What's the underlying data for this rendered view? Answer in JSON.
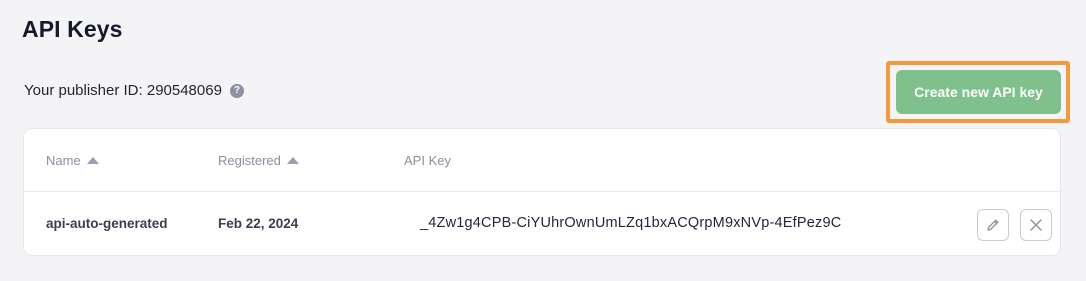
{
  "page": {
    "title": "API Keys"
  },
  "publisher": {
    "label": "Your publisher ID: 290548069",
    "help_icon": "question-icon"
  },
  "actions": {
    "create_label": "Create new API key"
  },
  "colors": {
    "accent_green": "#7fc08c",
    "highlight_orange": "#f39a3d"
  },
  "table": {
    "columns": [
      {
        "label": "Name",
        "sortable": true,
        "sort_icon": "sort-asc-icon"
      },
      {
        "label": "Registered",
        "sortable": true,
        "sort_icon": "sort-asc-icon"
      },
      {
        "label": "API Key",
        "sortable": false
      }
    ],
    "rows": [
      {
        "name": "api-auto-generated",
        "registered": "Feb 22, 2024",
        "api_key": "_4Zw1g4CPB-CiYUhrOwnUmLZq1bxACQrpM9xNVp-4EfPez9C",
        "actions": [
          "edit-icon",
          "close-icon"
        ]
      }
    ]
  }
}
